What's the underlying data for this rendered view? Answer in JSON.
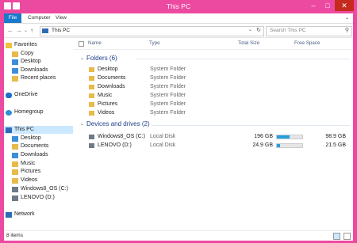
{
  "window": {
    "title": "This PC"
  },
  "ribbon": {
    "tabs": [
      "File",
      "Computer",
      "View"
    ]
  },
  "address": {
    "crumb": "This PC",
    "search_placeholder": "Search This PC"
  },
  "columns": {
    "name": "Name",
    "type": "Type",
    "total": "Total Size",
    "free": "Free Space"
  },
  "sidebar": {
    "favorites": "Favorites",
    "fav_items": [
      "Copy",
      "Desktop",
      "Downloads",
      "Recent places"
    ],
    "onedrive": "OneDrive",
    "homegroup": "Homegroup",
    "thispc": "This PC",
    "pc_items": [
      "Desktop",
      "Documents",
      "Downloads",
      "Music",
      "Pictures",
      "Videos",
      "Windows8_OS (C:)",
      "LENOVO (D:)"
    ],
    "network": "Network"
  },
  "folders": {
    "heading": "Folders (6)",
    "items": [
      {
        "name": "Desktop",
        "type": "System Folder"
      },
      {
        "name": "Documents",
        "type": "System Folder"
      },
      {
        "name": "Downloads",
        "type": "System Folder"
      },
      {
        "name": "Music",
        "type": "System Folder"
      },
      {
        "name": "Pictures",
        "type": "System Folder"
      },
      {
        "name": "Videos",
        "type": "System Folder"
      }
    ]
  },
  "drives": {
    "heading": "Devices and drives (2)",
    "items": [
      {
        "name": "Windows8_OS (C:)",
        "type": "Local Disk",
        "total": "196 GB",
        "free": "98.9 GB",
        "used_fraction": 0.5
      },
      {
        "name": "LENOVO (D:)",
        "type": "Local Disk",
        "total": "24.9 GB",
        "free": "21.5 GB",
        "used_fraction": 0.14
      }
    ]
  },
  "status": {
    "items": "8 items"
  },
  "colors": {
    "accent": "#ec4aa0",
    "file_tab": "#1979ca",
    "group_heading": "#1c3e87",
    "selection": "#cce8ff"
  }
}
